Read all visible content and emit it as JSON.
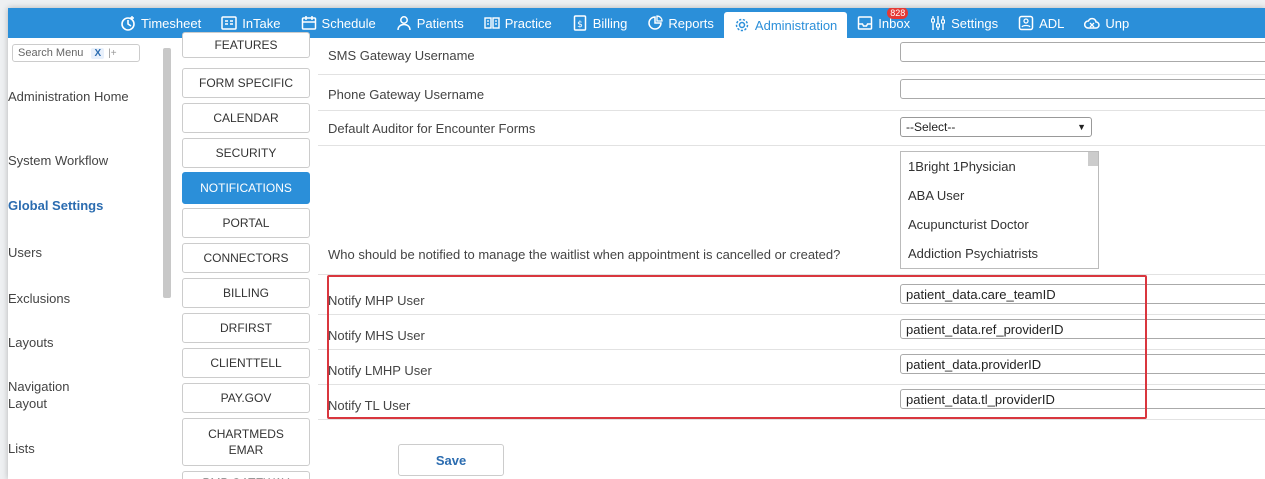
{
  "nav": [
    {
      "label": "Timesheet",
      "icon": "timesheet-icon"
    },
    {
      "label": "InTake",
      "icon": "intake-icon"
    },
    {
      "label": "Schedule",
      "icon": "calendar-icon"
    },
    {
      "label": "Patients",
      "icon": "person-icon"
    },
    {
      "label": "Practice",
      "icon": "practice-icon"
    },
    {
      "label": "Billing",
      "icon": "billing-icon"
    },
    {
      "label": "Reports",
      "icon": "reports-icon"
    },
    {
      "label": "Administration",
      "icon": "gear-icon"
    },
    {
      "label": "Inbox",
      "icon": "inbox-icon",
      "badge": "828"
    },
    {
      "label": "Settings",
      "icon": "sliders-icon"
    },
    {
      "label": "ADL",
      "icon": "adl-icon"
    },
    {
      "label": "Unp",
      "icon": "cloud-icon"
    }
  ],
  "sidebar": {
    "search_placeholder": "Search Menu",
    "search_clear": "X",
    "search_pin": "|+",
    "items": [
      {
        "label": "Administration Home"
      },
      {
        "label": "System Workflow"
      },
      {
        "label": "Global Settings"
      },
      {
        "label": "Users"
      },
      {
        "label": "Exclusions"
      },
      {
        "label": "Layouts"
      },
      {
        "label": "Navigation Layout"
      },
      {
        "label": "Lists"
      }
    ]
  },
  "categories": [
    {
      "label": "FEATURES"
    },
    {
      "label": "FORM SPECIFIC"
    },
    {
      "label": "CALENDAR"
    },
    {
      "label": "SECURITY"
    },
    {
      "label": "NOTIFICATIONS"
    },
    {
      "label": "PORTAL"
    },
    {
      "label": "CONNECTORS"
    },
    {
      "label": "BILLING"
    },
    {
      "label": "DRFIRST"
    },
    {
      "label": "CLIENTTELL"
    },
    {
      "label": "PAY.GOV"
    },
    {
      "label": "CHARTMEDS EMAR"
    },
    {
      "label": "PMP GATEWAY"
    }
  ],
  "settings": {
    "sms_label": "SMS Gateway Username",
    "sms_value": "",
    "phone_label": "Phone Gateway Username",
    "phone_value": "",
    "auditor_label": "Default Auditor for Encounter Forms",
    "auditor_value": "--Select--",
    "waitlist_label": "Who should be notified to manage the waitlist when appointment is cancelled or created?",
    "waitlist_options": [
      "1Bright 1Physician",
      "ABA User",
      "Acupuncturist Doctor",
      "Addiction Psychiatrists"
    ],
    "notify": [
      {
        "label": "Notify MHP User",
        "value": "patient_data.care_teamID"
      },
      {
        "label": "Notify MHS User",
        "value": "patient_data.ref_providerID"
      },
      {
        "label": "Notify LMHP User",
        "value": "patient_data.providerID"
      },
      {
        "label": "Notify TL User",
        "value": "patient_data.tl_providerID"
      }
    ],
    "save_label": "Save"
  },
  "colors": {
    "nav_blue": "#2b8fd9",
    "highlight_red": "#d9363e",
    "active_text": "#2b6cb0"
  }
}
